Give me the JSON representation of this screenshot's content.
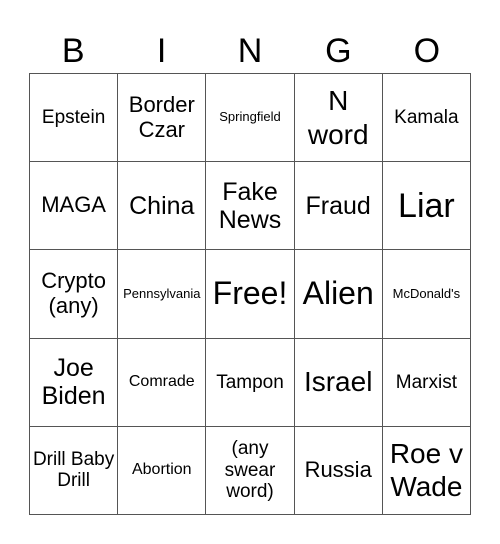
{
  "header": [
    "B",
    "I",
    "N",
    "G",
    "O"
  ],
  "cells": [
    [
      "Epstein",
      "Border Czar",
      "Springfield",
      "N word",
      "Kamala"
    ],
    [
      "MAGA",
      "China",
      "Fake News",
      "Fraud",
      "Liar"
    ],
    [
      "Crypto (any)",
      "Pennsylvania",
      "Free!",
      "Alien",
      "McDonald's"
    ],
    [
      "Joe Biden",
      "Comrade",
      "Tampon",
      "Israel",
      "Marxist"
    ],
    [
      "Drill Baby Drill",
      "Abortion",
      "(any swear word)",
      "Russia",
      "Roe v Wade"
    ]
  ]
}
